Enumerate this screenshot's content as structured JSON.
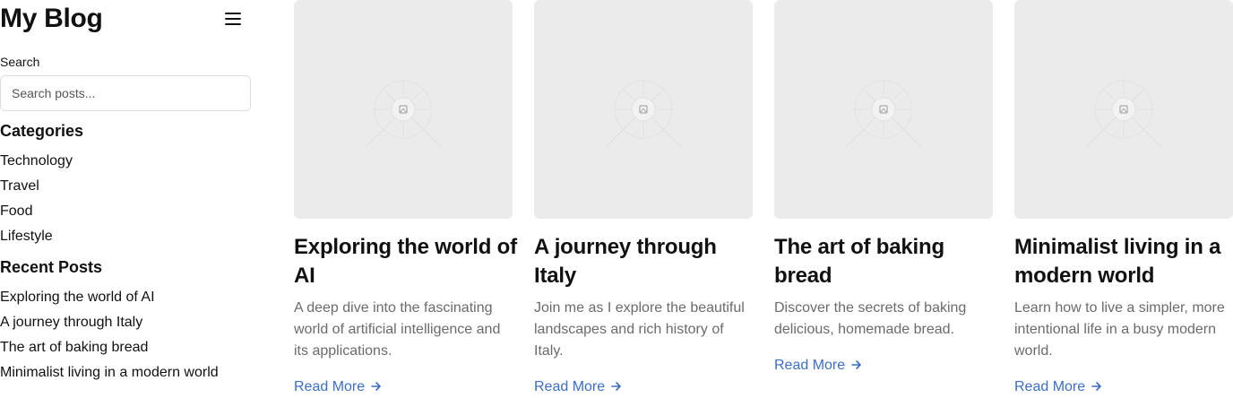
{
  "sidebar": {
    "brand": "My Blog",
    "menu_icon": "hamburger-menu-icon",
    "search": {
      "label": "Search",
      "placeholder": "Search posts...",
      "value": ""
    },
    "categories": {
      "title": "Categories",
      "items": [
        "Technology",
        "Travel",
        "Food",
        "Lifestyle"
      ]
    },
    "recent_posts": {
      "title": "Recent Posts",
      "items": [
        "Exploring the world of AI",
        "A journey through Italy",
        "The art of baking bread",
        "Minimalist living in a modern world"
      ]
    }
  },
  "posts": [
    {
      "title": "Exploring the world of AI",
      "description": "A deep dive into the fascinating world of artificial intelligence and its applications.",
      "read_more": "Read More"
    },
    {
      "title": "A journey through Italy",
      "description": "Join me as I explore the beautiful landscapes and rich history of Italy.",
      "read_more": "Read More"
    },
    {
      "title": "The art of baking bread",
      "description": "Discover the secrets of baking delicious, homemade bread.",
      "read_more": "Read More"
    },
    {
      "title": "Minimalist living in a modern world",
      "description": "Learn how to live a simpler, more intentional life in a busy modern world.",
      "read_more": "Read More"
    }
  ],
  "colors": {
    "link": "#3b6fc4",
    "muted_text": "#6b6b6b",
    "placeholder_bg": "#ebebeb"
  }
}
